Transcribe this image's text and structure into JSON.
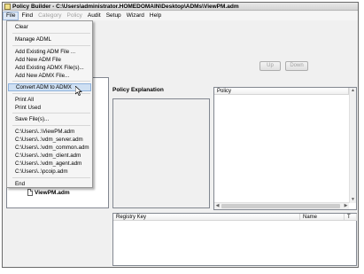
{
  "window": {
    "title": "Policy Builder - C:\\Users\\administrator.HOMEDOMAIN\\Desktop\\ADMs\\ViewPM.adm"
  },
  "menubar": {
    "items": [
      "File",
      "Find",
      "Category",
      "Policy",
      "Audit",
      "Setup",
      "Wizard",
      "Help"
    ]
  },
  "file_menu": {
    "items": [
      "Clear",
      "Manage ADML",
      "Add Existing ADM File ...",
      "Add New ADM File",
      "Add Existing ADMX File(s)...",
      "Add New ADMX File...",
      "Convert ADM to ADMX",
      "Print All",
      "Print Used",
      "Save File(s)...",
      "C:\\Users\\..\\ViewPM.adm",
      "C:\\Users\\..\\vdm_server.adm",
      "C:\\Users\\..\\vdm_common.adm",
      "C:\\Users\\..\\vdm_client.adm",
      "C:\\Users\\..\\vdm_agent.adm",
      "C:\\Users\\..\\pcoip.adm",
      "End"
    ]
  },
  "toolbar": {
    "up_label": "Up",
    "down_label": "Down"
  },
  "labels": {
    "policy_explanation": "Policy Explanation"
  },
  "policy_table": {
    "header": "Policy"
  },
  "registry_table": {
    "headers": [
      "Registry Key",
      "Name",
      "T"
    ]
  },
  "tree": {
    "items": [
      "ViewPM.adm"
    ]
  }
}
